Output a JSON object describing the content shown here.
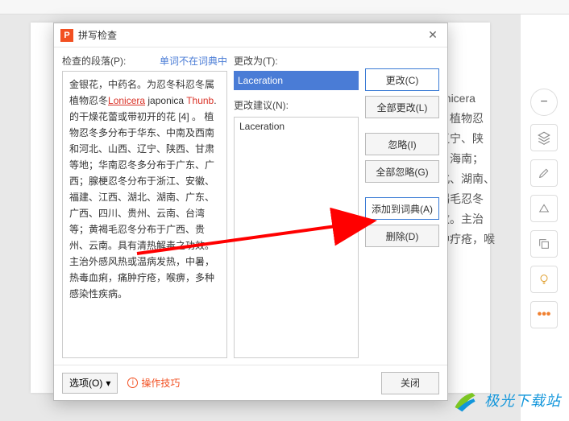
{
  "topbar": {
    "item": "···"
  },
  "dialog": {
    "title": "拼写检查",
    "close": "✕",
    "passageLabel": "检查的段落(P):",
    "notInDict": "单词不在词典中",
    "passage": {
      "p1a": "金银花，中药名。为忍冬科忍冬属植物忍冬",
      "p1red1": "Lonicera",
      "p1mid": " japonica ",
      "p1red2": "Thunb",
      "p1b": ".的干燥花蕾或带初开的花 [4] 。 植物忍冬多分布于华东、中南及西南和河北、山西、辽宁、陕西、甘肃等地；华南忍冬多分布于广东、广西；腺梗忍冬分布于浙江、安徽、福建、江西、湖北、湖南、广东、广西、四川、贵州、云南、台湾等；黄褐毛忍冬分布于广西、贵州、云南。具有清热解毒之功效。主治外感风热或温病发热，中暑，热毒血痢，痛肿疔疮，喉痹，多种感染性疾病。"
    },
    "changeLabel": "更改为(T):",
    "changeValue": "Laceration",
    "suggLabel": "更改建议(N):",
    "sugg": "Laceration",
    "buttons": {
      "change": "更改(C)",
      "changeAll": "全部更改(L)",
      "ignore": "忽略(I)",
      "ignoreAll": "全部忽略(G)",
      "addDict": "添加到词典(A)",
      "delete": "删除(D)"
    },
    "footer": {
      "options": "选项(O)",
      "tips": "操作技巧",
      "close": "关闭"
    }
  },
  "bgtext": {
    "l1": "onicera",
    "l2": "。植物忍",
    "l3": "辽宁、陕",
    "l4": "、海南；",
    "l5": "北、湖南、",
    "l6": "褐毛忍冬",
    "l7": "效。主治",
    "l8": "肿疔疮，喉"
  },
  "watermark": "极光下载站"
}
